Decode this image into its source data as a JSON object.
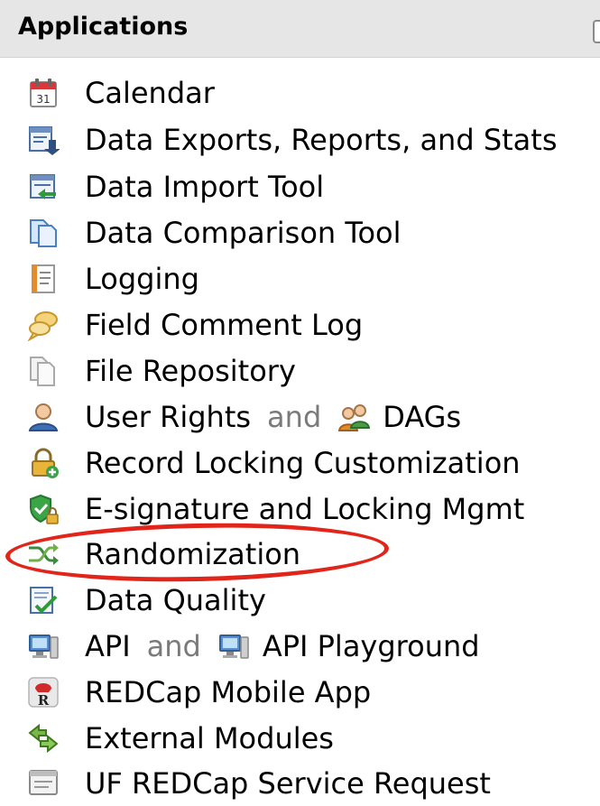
{
  "panel": {
    "title": "Applications"
  },
  "items": [
    {
      "label": "Calendar",
      "icon": "calendar-icon"
    },
    {
      "label": "Data Exports, Reports, and Stats",
      "icon": "data-export-icon"
    },
    {
      "label": "Data Import Tool",
      "icon": "data-import-icon"
    },
    {
      "label": "Data Comparison Tool",
      "icon": "data-comparison-icon"
    },
    {
      "label": "Logging",
      "icon": "logging-icon"
    },
    {
      "label": "Field Comment Log",
      "icon": "comment-bubbles-icon"
    },
    {
      "label": "File Repository",
      "icon": "file-repository-icon"
    },
    {
      "label": "User Rights",
      "icon": "user-icon",
      "joiner": "and",
      "second_label": "DAGs",
      "second_icon": "group-users-icon"
    },
    {
      "label": "Record Locking Customization",
      "icon": "lock-add-icon"
    },
    {
      "label": "E-signature and Locking Mgmt",
      "icon": "shield-lock-icon"
    },
    {
      "label": "Randomization",
      "icon": "randomization-arrows-icon"
    },
    {
      "label": "Data Quality",
      "icon": "data-quality-icon"
    },
    {
      "label": "API",
      "icon": "computer-icon",
      "joiner": "and",
      "second_label": "API Playground",
      "second_icon": "computer-icon"
    },
    {
      "label": "REDCap Mobile App",
      "icon": "redcap-mobile-icon"
    },
    {
      "label": "External Modules",
      "icon": "puzzle-arrows-icon"
    },
    {
      "label": "UF REDCap Service Request",
      "icon": "service-request-icon"
    }
  ],
  "annotation": {
    "highlighted_item": "Randomization",
    "color": "#e1251b"
  }
}
